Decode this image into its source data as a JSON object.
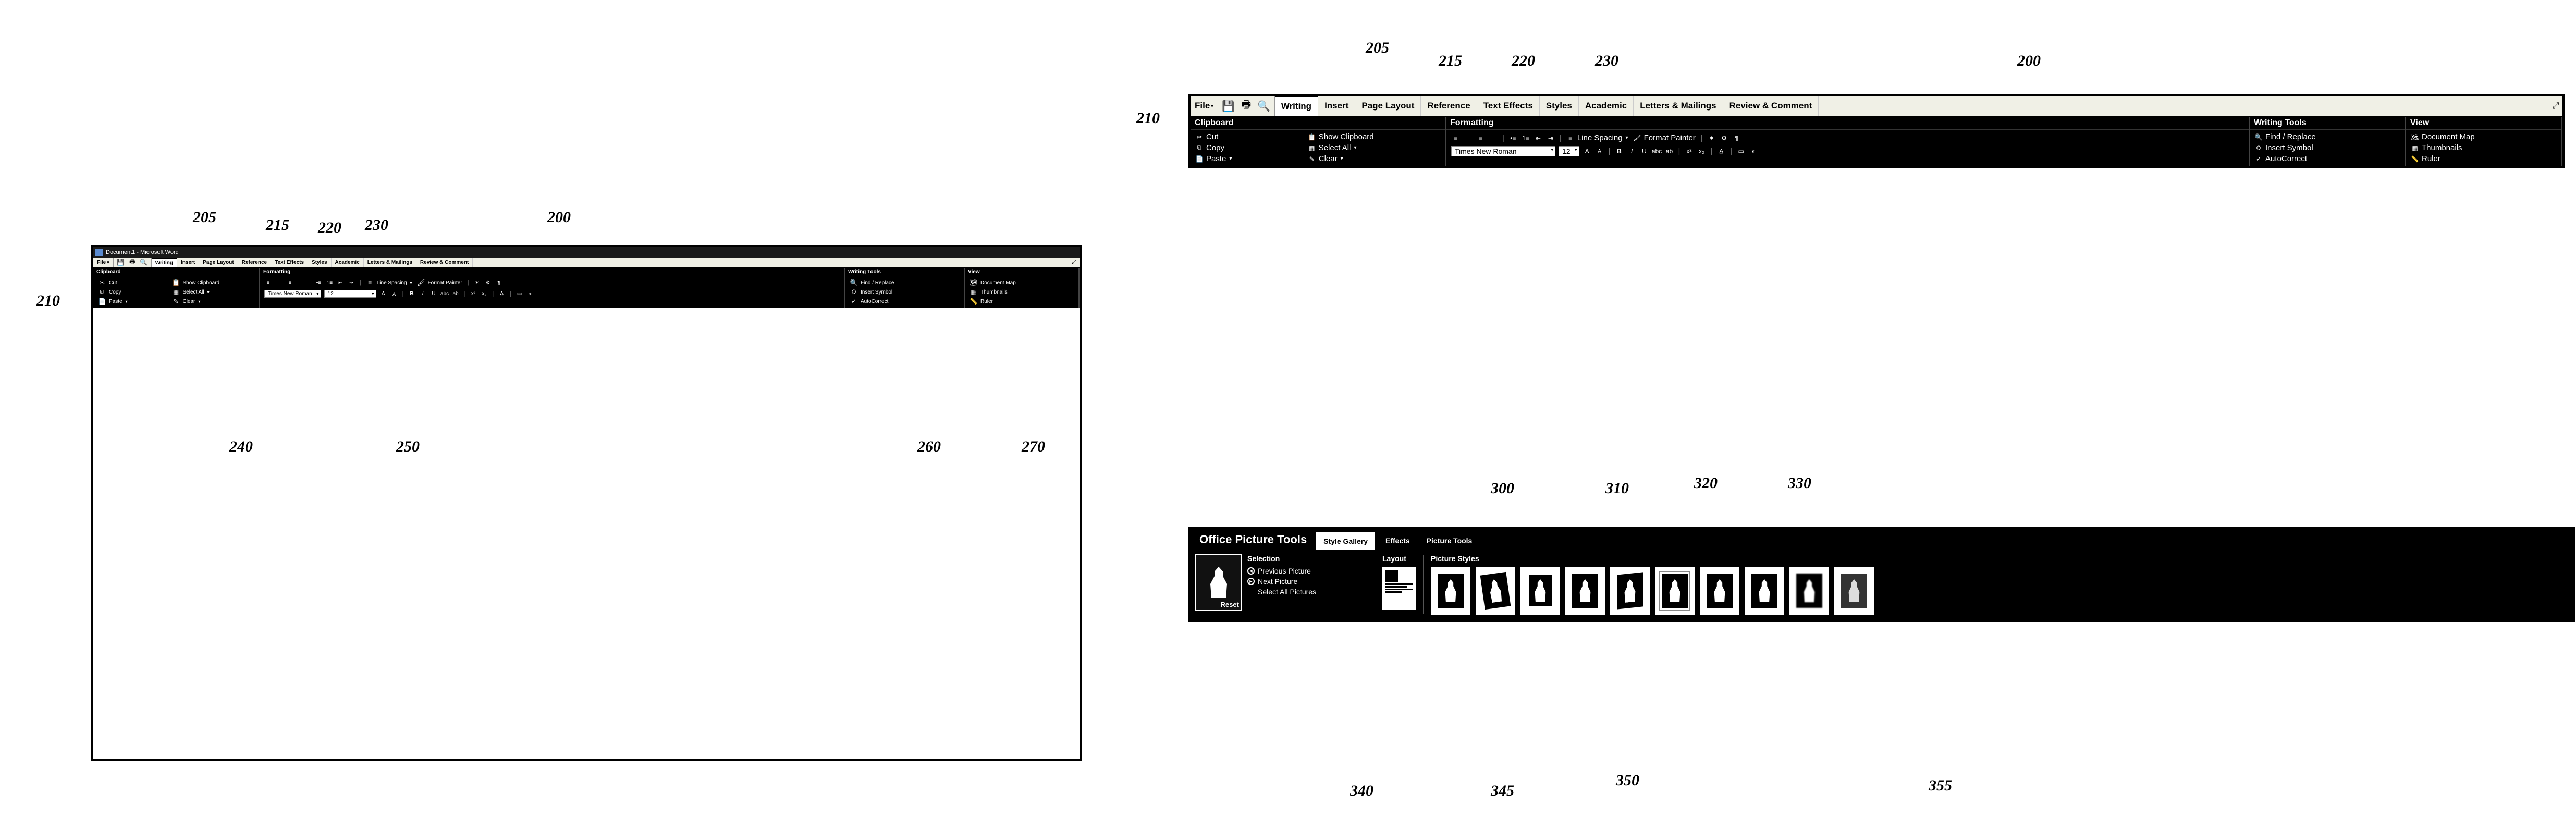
{
  "titlebar": {
    "text": "Document1 - Microsoft Word"
  },
  "file_label": "File",
  "tabs": {
    "writing": "Writing",
    "insert": "Insert",
    "page_layout": "Page Layout",
    "reference": "Reference",
    "text_effects": "Text Effects",
    "styles": "Styles",
    "academic": "Academic",
    "letters": "Letters & Mailings",
    "review": "Review & Comment"
  },
  "groups": {
    "clipboard": {
      "title": "Clipboard",
      "cut": "Cut",
      "copy": "Copy",
      "paste": "Paste",
      "show_clipboard": "Show Clipboard",
      "select_all": "Select All",
      "clear": "Clear"
    },
    "formatting": {
      "title": "Formatting",
      "line_spacing": "Line Spacing",
      "format_painter": "Format Painter",
      "font_name": "Times New Roman",
      "font_size": "12"
    },
    "writing_tools": {
      "title": "Writing Tools",
      "find_replace": "Find / Replace",
      "insert_symbol": "Insert Symbol",
      "autocorrect": "AutoCorrect"
    },
    "view": {
      "title": "View",
      "document_map": "Document Map",
      "thumbnails": "Thumbnails",
      "ruler": "Ruler"
    }
  },
  "picture_tools": {
    "title": "Office Picture Tools",
    "tabs": {
      "style_gallery": "Style Gallery",
      "effects": "Effects",
      "picture_tools": "Picture Tools"
    },
    "selection": {
      "title": "Selection",
      "reset": "Reset",
      "prev": "Previous Picture",
      "next": "Next Picture",
      "select_all": "Select All Pictures"
    },
    "layout": {
      "title": "Layout"
    },
    "styles": {
      "title": "Picture Styles"
    }
  },
  "callouts": {
    "c200": "200",
    "c205": "205",
    "c210": "210",
    "c215": "215",
    "c220": "220",
    "c230": "230",
    "c240": "240",
    "c250": "250",
    "c260": "260",
    "c270": "270",
    "c300": "300",
    "c310": "310",
    "c320": "320",
    "c330": "330",
    "c340": "340",
    "c345": "345",
    "c350": "350",
    "c355": "355"
  }
}
